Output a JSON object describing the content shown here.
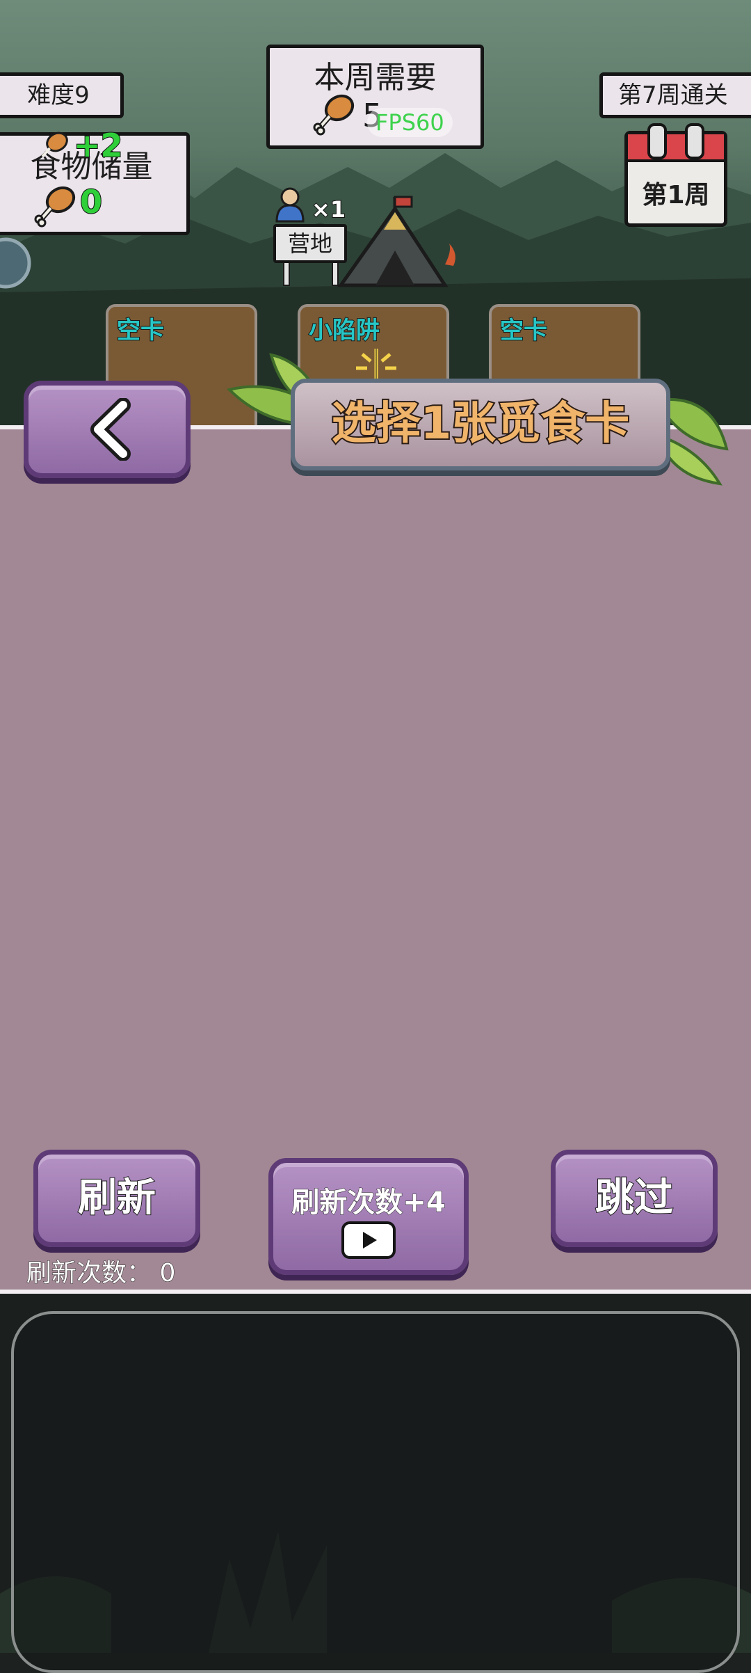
{
  "hud": {
    "difficulty": "难度9",
    "week_need_title": "本周需要",
    "week_need_value": "5",
    "fps": "FPS60",
    "week_clear": "第7周通关",
    "food_title": "食物储量",
    "food_value": "0",
    "food_gain": "+2",
    "calendar_label": "第1周",
    "camp_label": "营地",
    "camp_people": "×1"
  },
  "cards": [
    {
      "title": "空卡"
    },
    {
      "title": "小陷阱"
    },
    {
      "title": "空卡"
    }
  ],
  "banner": {
    "title": "选择1张觅食卡"
  },
  "actions": {
    "refresh": "刷新",
    "refresh_plus": "刷新次数+4",
    "skip": "跳过",
    "refresh_count": "刷新次数： 0"
  },
  "colors": {
    "overlay": "#a28894",
    "stone_button": "#a47db7",
    "card_title": "#26c7c6",
    "gain_green": "#2fcf3a"
  },
  "icons": [
    "back-arrow-icon",
    "drumstick-icon",
    "calendar-icon",
    "person-icon",
    "tent-icon",
    "play-icon",
    "trap-icon"
  ]
}
